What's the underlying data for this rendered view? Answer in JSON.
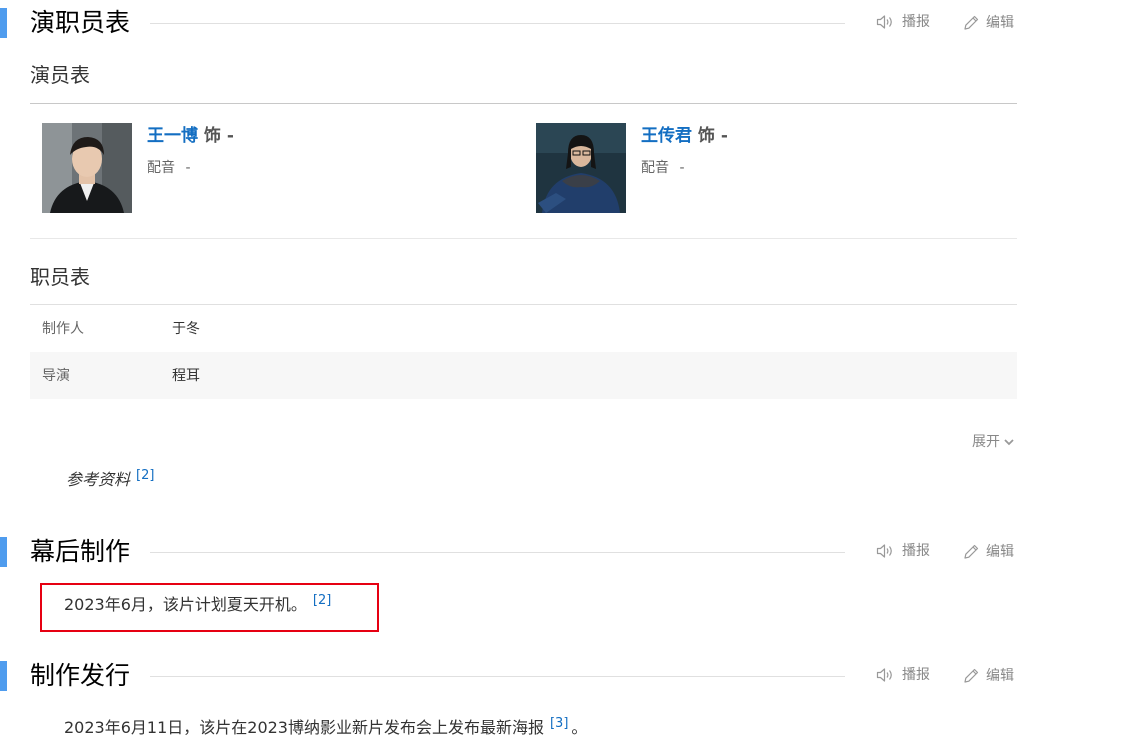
{
  "toolbar": {
    "broadcast_label": "播报",
    "edit_label": "编辑"
  },
  "cast_section": {
    "title": "演职员表",
    "cast_subtitle": "演员表",
    "actors": [
      {
        "name": "王一博",
        "role_suffix": "饰 -",
        "dub_label": "配音",
        "dub_value": "-"
      },
      {
        "name": "王传君",
        "role_suffix": "饰 -",
        "dub_label": "配音",
        "dub_value": "-"
      }
    ],
    "crew_subtitle": "职员表",
    "crew": [
      {
        "key": "制作人",
        "value": "于冬"
      },
      {
        "key": "导演",
        "value": "程耳"
      }
    ],
    "expand_label": "展开",
    "reference_label": "参考资料",
    "reference_mark": "[2]"
  },
  "production_section": {
    "title": "幕后制作",
    "text": "2023年6月，该片计划夏天开机。",
    "ref": "[2]"
  },
  "release_section": {
    "title": "制作发行",
    "text": "2023年6月11日，该片在2023博纳影业新片发布会上发布最新海报",
    "ref": "[3]",
    "end": "。"
  },
  "colors": {
    "accent": "#4f9cee",
    "link": "#136ec2",
    "highlight_box": "#e60012"
  }
}
